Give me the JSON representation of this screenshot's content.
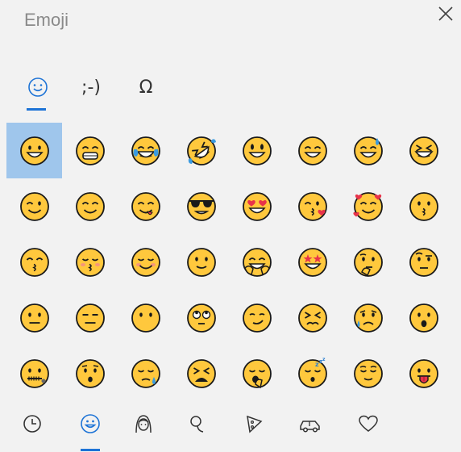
{
  "window": {
    "title": "Emoji"
  },
  "tabs": [
    {
      "label": "☺",
      "name": "tab-emoji",
      "active": true
    },
    {
      "label": ";-)",
      "name": "tab-kaomoji",
      "active": false
    },
    {
      "label": "Ω",
      "name": "tab-symbols",
      "active": false
    }
  ],
  "emoji_grid": [
    [
      "grinning-face",
      "beaming-face",
      "tears-of-joy-face",
      "rolling-laughing-face",
      "grinning-big-eyes-face",
      "grinning-smiling-eyes-face",
      "grinning-sweat-face",
      "squinting-laughing-face"
    ],
    [
      "winking-face",
      "smiling-eyes-face",
      "savoring-food-face",
      "sunglasses-face",
      "heart-eyes-face",
      "kissing-heart-face",
      "smiling-hearts-face",
      "kissing-face"
    ],
    [
      "kissing-smiling-eyes-face",
      "kissing-closed-eyes-face",
      "smiling-face",
      "slightly-smiling-face",
      "hugging-face",
      "star-struck-face",
      "thinking-face",
      "face-raised-eyebrow"
    ],
    [
      "neutral-face",
      "expressionless-face",
      "face-without-mouth",
      "face-rolling-eyes",
      "smirking-face",
      "persevering-face",
      "sad-relieved-face",
      "face-open-mouth"
    ],
    [
      "zipper-mouth-face",
      "hushed-face",
      "sleepy-face",
      "tired-face",
      "yawning-face",
      "sleeping-face",
      "relieved-face",
      "face-with-tongue"
    ]
  ],
  "selected": {
    "row": 0,
    "col": 0
  },
  "bottom_categories": [
    {
      "name": "recent-icon",
      "active": false
    },
    {
      "name": "smiley-category-icon",
      "active": true
    },
    {
      "name": "people-category-icon",
      "active": false
    },
    {
      "name": "nature-category-icon",
      "active": false
    },
    {
      "name": "food-category-icon",
      "active": false
    },
    {
      "name": "travel-category-icon",
      "active": false
    },
    {
      "name": "heart-category-icon",
      "active": false
    }
  ],
  "colors": {
    "accent": "#1d73d6",
    "selection": "#9fc6ec",
    "emoji_fill": "#ffc83d",
    "emoji_outline": "#1a1a1a"
  }
}
